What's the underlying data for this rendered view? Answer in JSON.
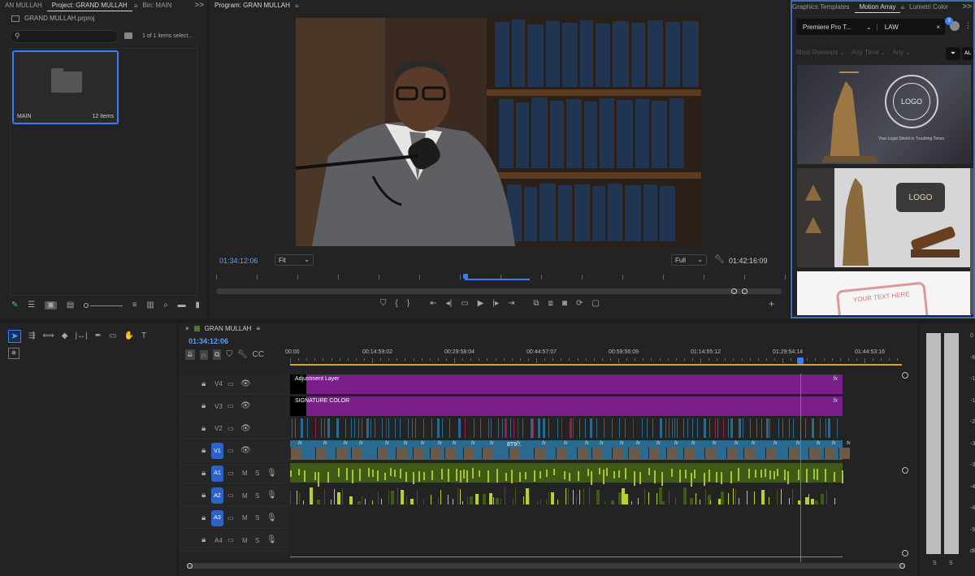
{
  "project": {
    "tabs": [
      "AN MULLAH",
      "Project: GRAND MULLAH",
      "Bin: MAIN"
    ],
    "more": ">>",
    "file": "GRAND MULLAH.prproj",
    "search_placeholder": "",
    "selection": "1 of 1 items select...",
    "bin": {
      "name": "MAIN",
      "count": "12 items"
    }
  },
  "program": {
    "title": "Program: GRAN MULLAH",
    "menu": "≡",
    "timecode": "01:34:12:06",
    "fit": "Fit",
    "quality": "Full",
    "duration": "01:42:16:09",
    "playhead_fraction": 0.6
  },
  "motion": {
    "tabs": [
      "Graphics Templates",
      "Motion Array",
      "Lumetri Color"
    ],
    "more": ">>",
    "dropdown": "Premiere Pro T...",
    "search_value": "LAW",
    "badge": "3",
    "filters": [
      "Most Relevant",
      "Any Time",
      "Any"
    ],
    "filter_extra": "AL",
    "thumb1_logo": "LOGO",
    "thumb1_caption": "Your Legal Shield in Troubling Times",
    "thumb2_logo": "LOGO",
    "thumb3_text": "YOUR TEXT HERE"
  },
  "timeline": {
    "sequence": "GRAN MULLAH",
    "timecode": "01:34:12:06",
    "ruler": [
      "00:00",
      "00:14:59:02",
      "00:29:58:04",
      "00:44:57:07",
      "00:59:56:09",
      "01:14:55:12",
      "01:29:54:14",
      "01:44:53:16"
    ],
    "tracks": [
      {
        "name": "V4",
        "clip": "Adjustment Layer"
      },
      {
        "name": "V3",
        "clip": "SIGNATURE COLOR"
      },
      {
        "name": "V2",
        "clip": ""
      },
      {
        "name": "V1",
        "clip": "8T9..."
      },
      {
        "name": "A1",
        "clip": ""
      },
      {
        "name": "A2",
        "clip": ""
      },
      {
        "name": "A3",
        "clip": ""
      },
      {
        "name": "A4",
        "clip": ""
      }
    ],
    "fx": "fx",
    "mute": "M",
    "solo": "S"
  },
  "meters": {
    "scale": [
      "0",
      "-6",
      "-12",
      "-18",
      "-24",
      "-30",
      "-36",
      "-42",
      "-48",
      "-54",
      "dB"
    ],
    "solo": [
      "S",
      "S"
    ]
  },
  "colors": {
    "accent": "#2b63c6",
    "purple": "#7a1f8a",
    "video": "#2a6a8e",
    "audio": "#3f5a12",
    "playhead": "#3d7cff"
  }
}
